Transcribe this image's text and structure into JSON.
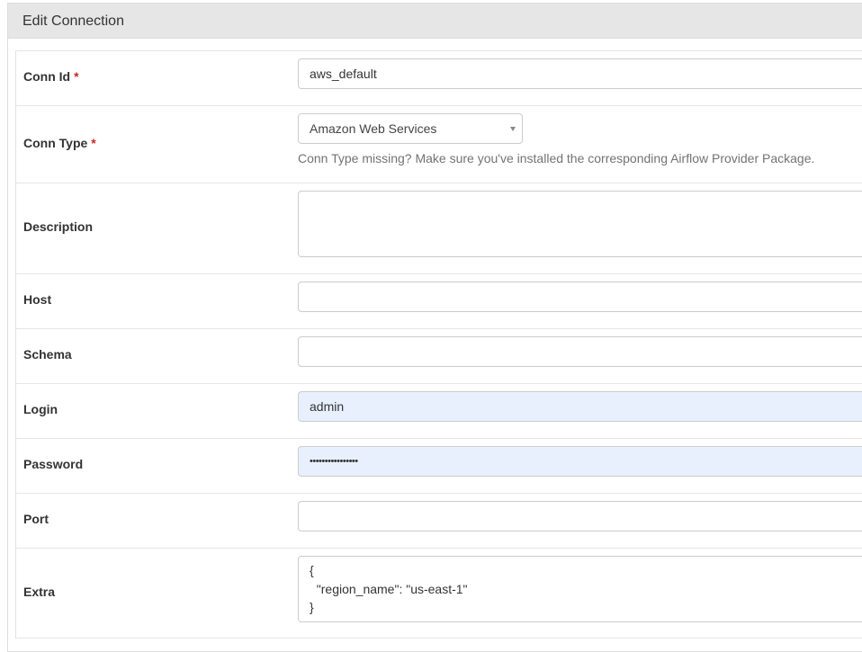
{
  "panel": {
    "title": "Edit Connection"
  },
  "form": {
    "required_marker": "*",
    "conn_id": {
      "label": "Conn Id",
      "value": "aws_default"
    },
    "conn_type": {
      "label": "Conn Type",
      "selected": "Amazon Web Services",
      "help": "Conn Type missing? Make sure you've installed the corresponding Airflow Provider Package."
    },
    "description": {
      "label": "Description",
      "value": ""
    },
    "host": {
      "label": "Host",
      "value": ""
    },
    "schema": {
      "label": "Schema",
      "value": ""
    },
    "login": {
      "label": "Login",
      "value": "admin"
    },
    "password": {
      "label": "Password",
      "value": "••••••••••••••••"
    },
    "port": {
      "label": "Port",
      "value": ""
    },
    "extra": {
      "label": "Extra",
      "value": "{\n  \"region_name\": \"us-east-1\"\n}"
    }
  },
  "icons": {
    "select_caret": "chevron-down-icon"
  }
}
